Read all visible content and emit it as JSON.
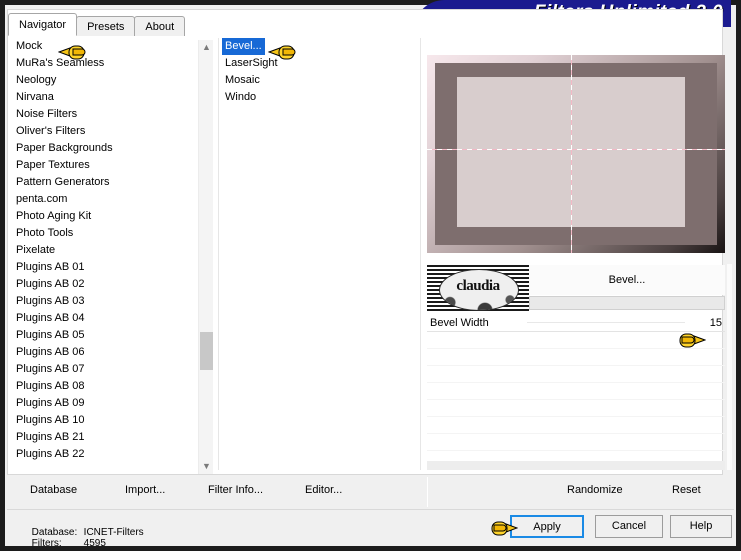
{
  "window": {
    "title": "Filters Unlimited 2.0",
    "accent_color": "#1b1b8f",
    "selection_color": "#1769d6",
    "focus_color": "#1a8ae5"
  },
  "tabs": [
    {
      "label": "Navigator",
      "active": true
    },
    {
      "label": "Presets",
      "active": false
    },
    {
      "label": "About",
      "active": false
    }
  ],
  "navigator": {
    "items": [
      "Mock",
      "MuRa's Seamless",
      "Neology",
      "Nirvana",
      "Noise Filters",
      "Oliver's Filters",
      "Paper Backgrounds",
      "Paper Textures",
      "Pattern Generators",
      "penta.com",
      "Photo Aging Kit",
      "Photo Tools",
      "Pixelate",
      "Plugins AB 01",
      "Plugins AB 02",
      "Plugins AB 03",
      "Plugins AB 04",
      "Plugins AB 05",
      "Plugins AB 06",
      "Plugins AB 07",
      "Plugins AB 08",
      "Plugins AB 09",
      "Plugins AB 10",
      "Plugins AB 21",
      "Plugins AB 22"
    ],
    "selected": "Mock",
    "scroll_up_icon": "chevron-up-icon",
    "scroll_down_icon": "chevron-down-icon"
  },
  "filters": {
    "items": [
      "Bevel...",
      "LaserSight",
      "Mosaic",
      "Windo"
    ],
    "selected": "Bevel..."
  },
  "preview": {
    "label": "bevel-effect-preview"
  },
  "filter_panel": {
    "name": "Bevel...",
    "watermark_text": "claudia",
    "parameters": [
      {
        "label": "Bevel Width",
        "value": "15"
      }
    ],
    "empty_row_count": 8
  },
  "menu": {
    "database": "Database",
    "import": "Import...",
    "filter_info": "Filter Info...",
    "editor": "Editor...",
    "randomize": "Randomize",
    "reset": "Reset"
  },
  "status": {
    "database_key": "Database:",
    "database_value": "ICNET-Filters",
    "filters_key": "Filters:",
    "filters_value": "4595"
  },
  "buttons": {
    "apply": "Apply",
    "cancel": "Cancel",
    "help": "Help"
  }
}
